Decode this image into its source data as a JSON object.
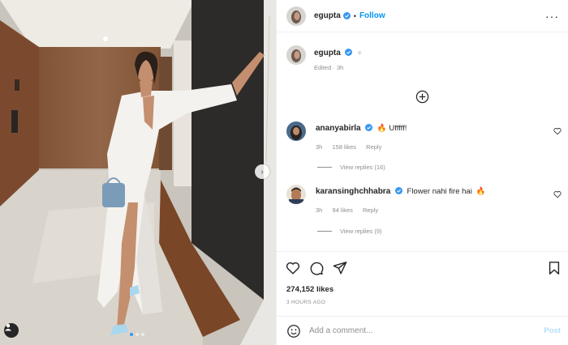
{
  "post_header": {
    "username": "egupta",
    "separator": "•",
    "follow_label": "Follow",
    "more_label": "···"
  },
  "caption": {
    "username": "egupta",
    "edited_label": "Edited",
    "edited_time": "3h"
  },
  "comments": [
    {
      "username": "ananyabirla",
      "text": "Ufffff!",
      "time": "3h",
      "likes": "158 likes",
      "reply_label": "Reply",
      "view_replies": "View replies (16)"
    },
    {
      "username": "karansinghchhabra",
      "text": "Flower nahi fire hai",
      "time": "3h",
      "likes": "94 likes",
      "reply_label": "Reply",
      "view_replies": "View replies (9)"
    }
  ],
  "stats": {
    "likes": "274,152 likes",
    "posted_ago": "3 HOURS AGO"
  },
  "add_comment": {
    "placeholder": "Add a comment...",
    "post_label": "Post"
  },
  "carousel": {
    "slide_count": 3,
    "active_index": 0
  },
  "icons": [
    "verified-icon",
    "more-icon",
    "load-more-icon",
    "heart-icon",
    "comment-icon",
    "share-icon",
    "save-icon",
    "emoji-icon",
    "fire-emoji-icon",
    "sparkle-emoji-icon",
    "next-arrow-icon",
    "user-tag-icon"
  ],
  "colors": {
    "accent": "#0095f6",
    "verified": "#3897f0",
    "muted": "#8e8e8e",
    "post_disabled": "#b2dffc"
  }
}
